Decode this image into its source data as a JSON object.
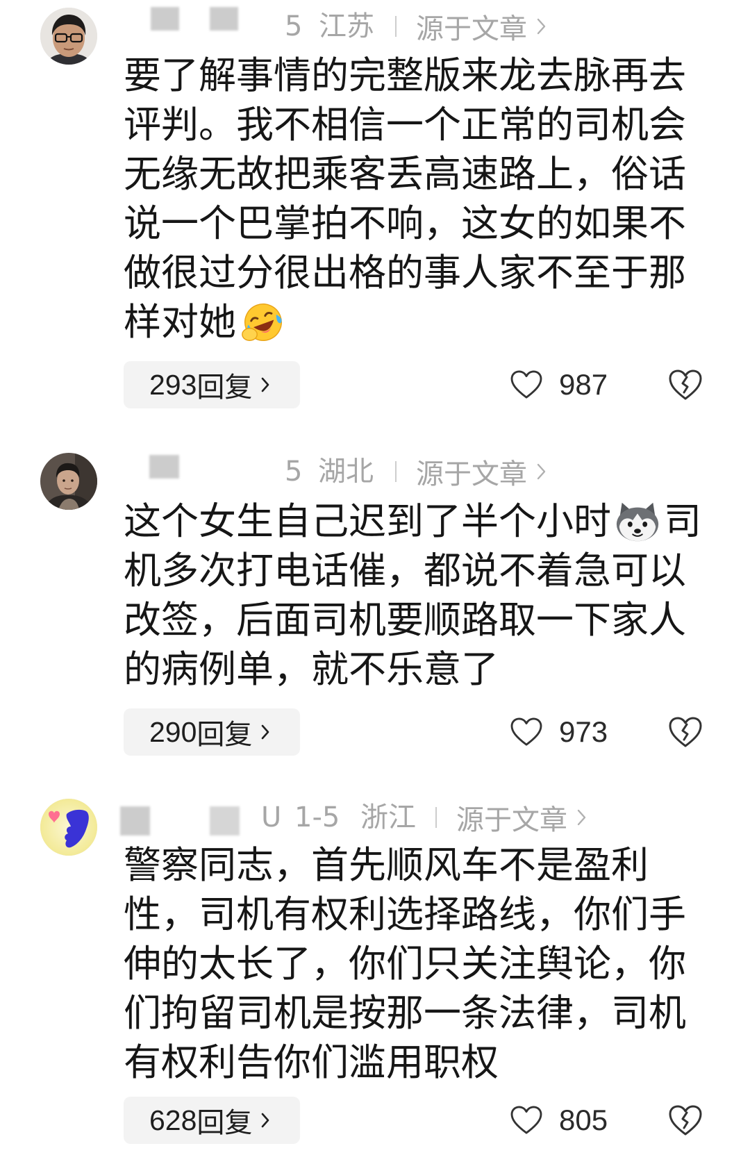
{
  "comments": [
    {
      "avatar": "avatar-man-with-glasses",
      "date": "5",
      "location": "江苏",
      "source": "源于文章",
      "lines": [
        "要了解事情的完整版来龙去脉再去",
        "评判。我不相信一个正常的司机会",
        "无缘无故把乘客丢高速路上，俗话",
        "说一个巴掌拍不响，这女的如果不",
        "做很过分很出格的事人家不至于那",
        "样对她"
      ],
      "emoji": "laughing-crying-emoji",
      "reply_count": "293",
      "reply_label": "回复",
      "like_count": "987"
    },
    {
      "avatar": "avatar-young-man-photo",
      "date": "5",
      "location": "湖北",
      "source": "源于文章",
      "lines": [
        "这个女生自己迟到了半个小时",
        "机多次打电话催，都说不着急可以",
        "改签，后面司机要顺路取一下家人",
        "的病例单，就不乐意了"
      ],
      "emoji": "husky-dog-emoji",
      "first_line_tail": "司",
      "reply_count": "290",
      "reply_label": "回复",
      "like_count": "973"
    },
    {
      "avatar": "avatar-cartoon-hand-heart",
      "name_fragment": "U",
      "date": "1-5",
      "location": "浙江",
      "source": "源于文章",
      "lines": [
        "警察同志，首先顺风车不是盈利",
        "性，司机有权利选择路线，你们手",
        "伸的太长了，你们只关注舆论，你",
        "们拘留司机是按那一条法律，司机",
        "有权利告你们滥用职权"
      ],
      "reply_count": "628",
      "reply_label": "回复",
      "like_count": "805"
    }
  ],
  "icons": {
    "like": "heart-outline-icon",
    "dislike": "broken-heart-icon",
    "chevron": "chevron-right-icon"
  },
  "colors": {
    "text": "#161616",
    "meta": "#a6a6a6",
    "reply_bg": "#f3f3f3"
  }
}
